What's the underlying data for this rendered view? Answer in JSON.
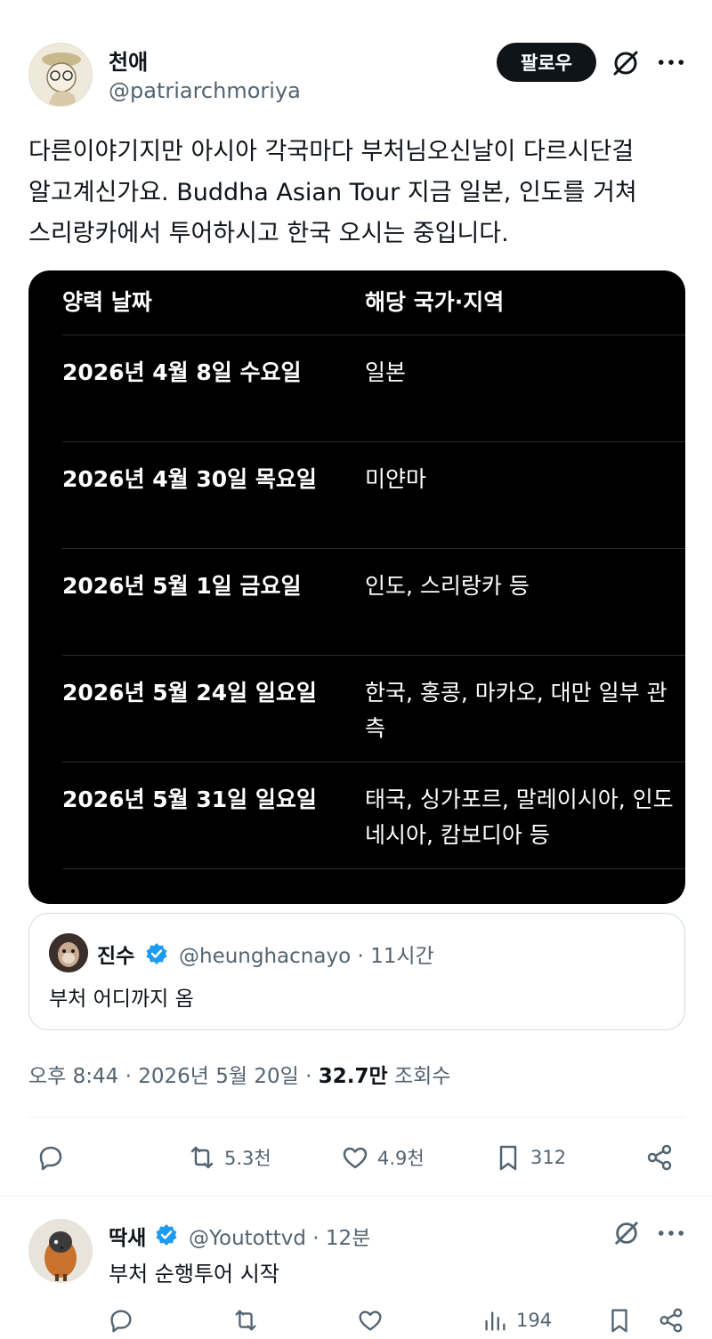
{
  "post": {
    "author_name": "천애",
    "author_handle": "@patriarchmoriya",
    "follow_label": "팔로우",
    "text_lines": [
      "다른이야기지만 아시아 각국마다 부처님오신날이 다르시단걸",
      "알고계신가요. Buddha Asian Tour 지금 일본, 인도를 거쳐",
      "스리랑카에서 투어하시고 한국 오시는 중입니다."
    ],
    "table": {
      "header_date": "양력 날짜",
      "header_country": "해당 국가·지역",
      "rows": [
        {
          "date": "2026년 4월 8일 수요일",
          "country": "일본"
        },
        {
          "date": "2026년 4월 30일 목요일",
          "country": "미얀마"
        },
        {
          "date": "2026년 5월 1일 금요일",
          "country": "인도, 스리랑카 등"
        },
        {
          "date": "2026년 5월 24일 일요일",
          "country": "한국, 홍콩, 마카오, 대만 일부 관측"
        },
        {
          "date": "2026년 5월 31일 일요일",
          "country": "태국, 싱가포르, 말레이시아, 인도네시아, 캄보디아 등"
        }
      ]
    },
    "quote": {
      "name": "진수",
      "handle": "@heunghacnayo",
      "time": "11시간",
      "text": "부처 어디까지 옴"
    },
    "meta": {
      "time": "오후 8:44",
      "date": "2026년 5월 20일",
      "views": "32.7만",
      "views_label": "조회수"
    },
    "actions": {
      "reply": "",
      "retweet": "5.3천",
      "like": "4.9천",
      "bookmark": "312"
    }
  },
  "reply": {
    "name": "딱새",
    "handle": "@Youtottvd",
    "time": "12분",
    "text": "부처 순행투어 시작",
    "views": "194"
  },
  "colors": {
    "text": "#0f1419",
    "secondary": "#536471",
    "verified": "#1d9bf0",
    "card_bg": "#000000"
  }
}
